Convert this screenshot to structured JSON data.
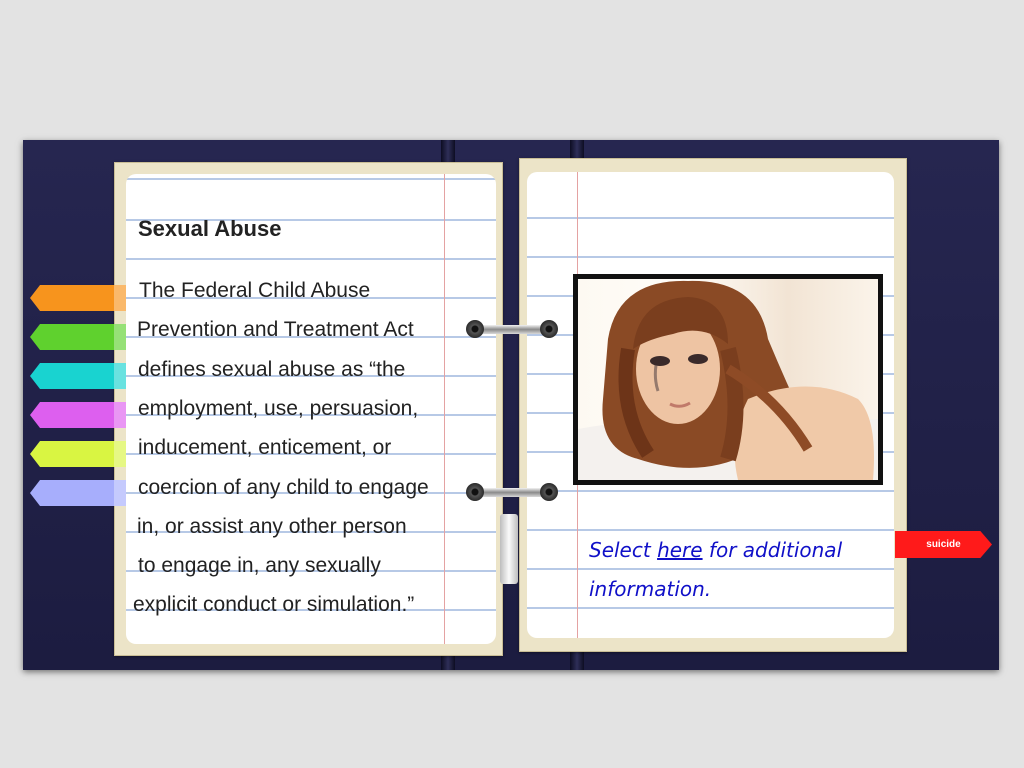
{
  "lesson": {
    "title": "Sexual Abuse",
    "body_lines": [
      "The Federal Child Abuse",
      "Prevention and Treatment Act",
      "defines sexual abuse as “the",
      "employment, use, persuasion,",
      "inducement, enticement, or",
      "coercion of any child to engage",
      "in,  or assist any other person",
      "to engage in, any sexually",
      "explicit conduct or simulation.”"
    ]
  },
  "nav_tabs": [
    {
      "color": "#f7941d"
    },
    {
      "color": "#5fd12e"
    },
    {
      "color": "#19d3d0"
    },
    {
      "color": "#dd5fef"
    },
    {
      "color": "#d9f542"
    },
    {
      "color": "#a7aefc"
    }
  ],
  "info_link": {
    "prefix": "Select ",
    "link_text": "here",
    "suffix": " for additional information."
  },
  "side_tab": {
    "label": "suicide",
    "color": "#ff1a1a"
  },
  "photo": {
    "icon": "photo-of-crying-woman"
  }
}
